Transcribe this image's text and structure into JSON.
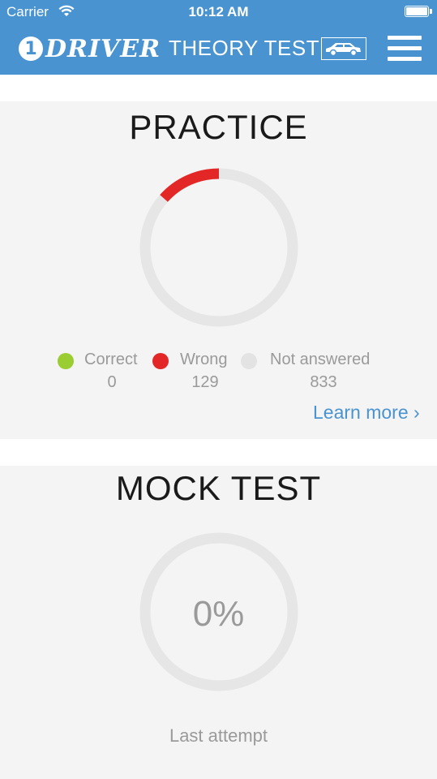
{
  "status_bar": {
    "carrier": "Carrier",
    "time": "10:12 AM"
  },
  "nav": {
    "logo_number": "1",
    "logo_text": "DRIVER",
    "title": "THEORY TEST",
    "car_icon": "car-icon",
    "menu_icon": "hamburger-menu-icon"
  },
  "practice": {
    "title": "PRACTICE",
    "legend": [
      {
        "label": "Correct",
        "count": "0",
        "color": "#9acd32"
      },
      {
        "label": "Wrong",
        "count": "129",
        "color": "#e32626"
      },
      {
        "label": "Not answered",
        "count": "833",
        "color": "#e3e3e3"
      }
    ],
    "progress": {
      "correct": 0,
      "wrong": 129,
      "not_answered": 833
    },
    "learn_more": "Learn more ›"
  },
  "mock_test": {
    "title": "MOCK TEST",
    "percent": "0%",
    "last_attempt": "Last attempt"
  },
  "colors": {
    "brand_blue": "#4a93d1",
    "ring_track": "#e6e6e6",
    "wrong_red": "#e32626",
    "card_bg": "#f4f4f4"
  }
}
